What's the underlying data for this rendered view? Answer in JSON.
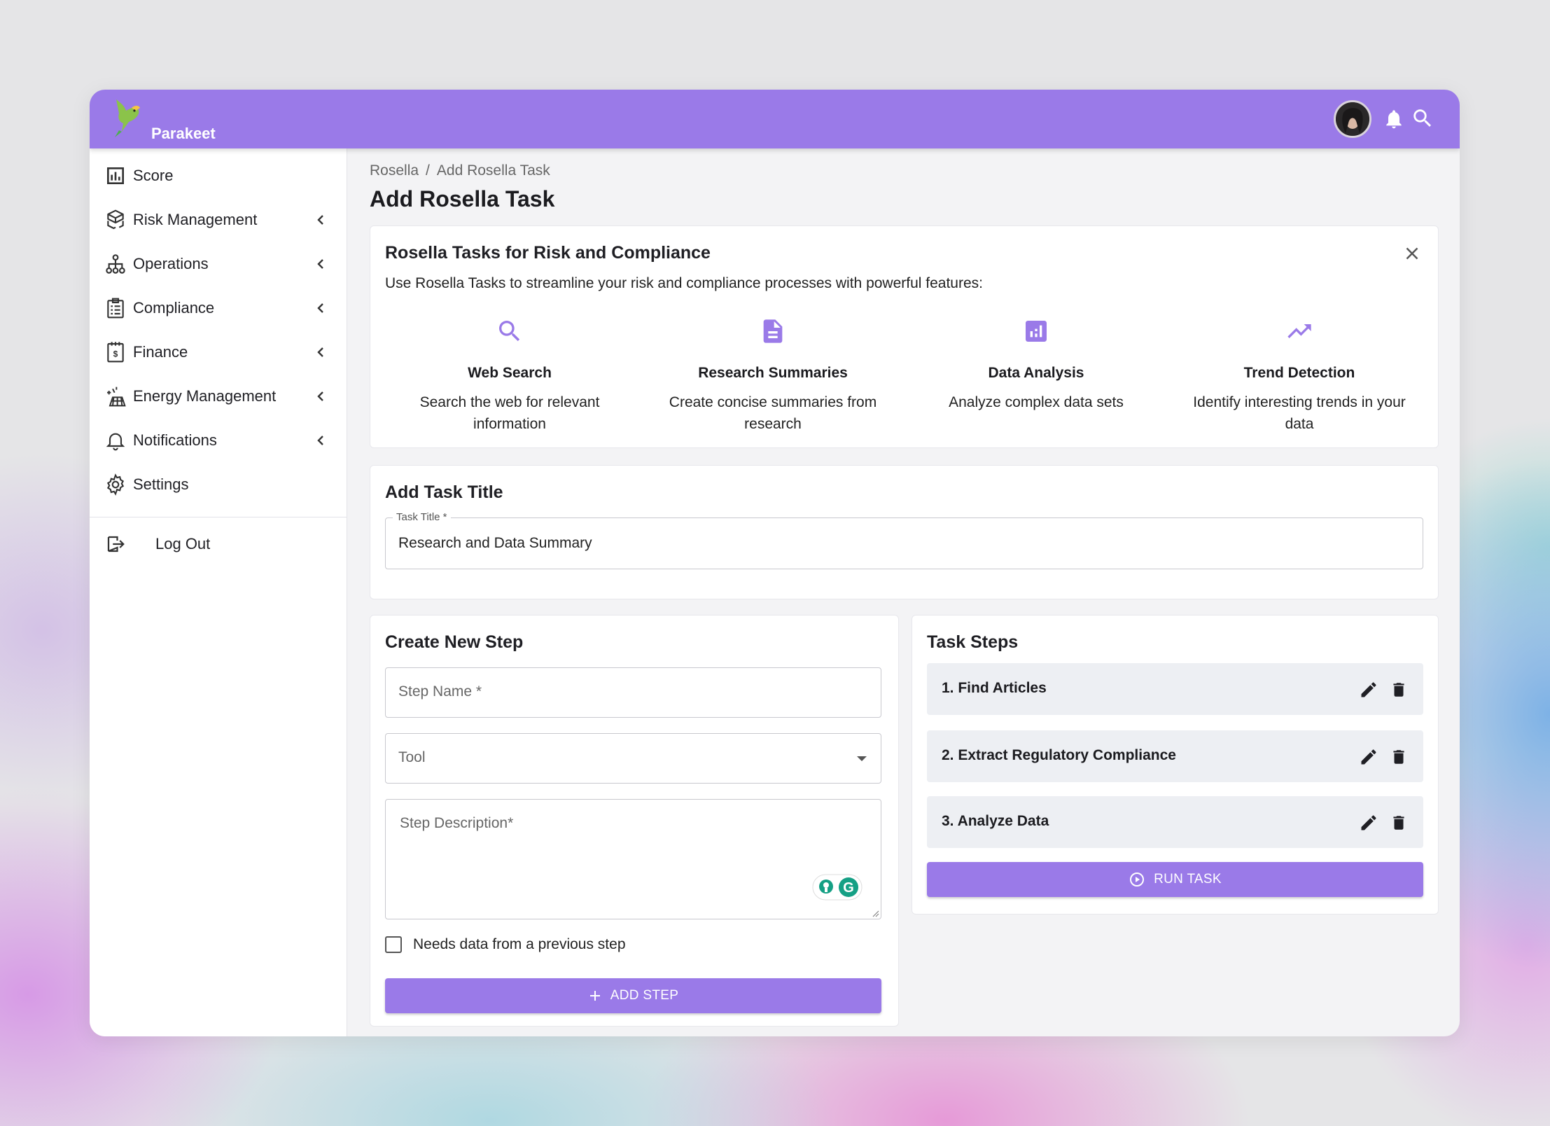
{
  "app": {
    "name": "Parakeet"
  },
  "sidebar": {
    "items": [
      {
        "label": "Score",
        "icon": "bar-chart-icon"
      },
      {
        "label": "Risk Management",
        "icon": "cubes-icon"
      },
      {
        "label": "Operations",
        "icon": "hierarchy-icon"
      },
      {
        "label": "Compliance",
        "icon": "checklist-icon"
      },
      {
        "label": "Finance",
        "icon": "invoice-icon"
      },
      {
        "label": "Energy Management",
        "icon": "energy-icon"
      },
      {
        "label": "Notifications",
        "icon": "bell-icon"
      },
      {
        "label": "Settings",
        "icon": "gear-icon"
      }
    ],
    "logout": "Log Out"
  },
  "breadcrumb": {
    "root": "Rosella",
    "sep": "/",
    "current": "Add Rosella Task"
  },
  "page_title": "Add Rosella Task",
  "info": {
    "title": "Rosella Tasks for Risk and Compliance",
    "description": "Use Rosella Tasks to streamline your risk and compliance processes with powerful features:",
    "features": [
      {
        "title": "Web Search",
        "desc": "Search the web for relevant information",
        "icon": "search-icon"
      },
      {
        "title": "Research Summaries",
        "desc": "Create concise summaries from research",
        "icon": "document-icon"
      },
      {
        "title": "Data Analysis",
        "desc": "Analyze complex data sets",
        "icon": "analytics-icon"
      },
      {
        "title": "Trend Detection",
        "desc": "Identify interesting trends in your data",
        "icon": "trending-up-icon"
      }
    ]
  },
  "task_title_section": {
    "heading": "Add Task Title",
    "field_label": "Task Title *",
    "value": "Research and Data Summary"
  },
  "create_step": {
    "heading": "Create New Step",
    "step_name_placeholder": "Step Name *",
    "tool_placeholder": "Tool",
    "description_placeholder": "Step Description*",
    "checkbox_label": "Needs data from a previous step",
    "add_button": "ADD STEP"
  },
  "task_steps": {
    "heading": "Task Steps",
    "steps": [
      "1. Find Articles",
      "2. Extract Regulatory Compliance",
      "3. Analyze Data"
    ],
    "run_button": "RUN TASK"
  },
  "colors": {
    "accent": "#9a7ae8",
    "row_bg": "#edeff3"
  }
}
